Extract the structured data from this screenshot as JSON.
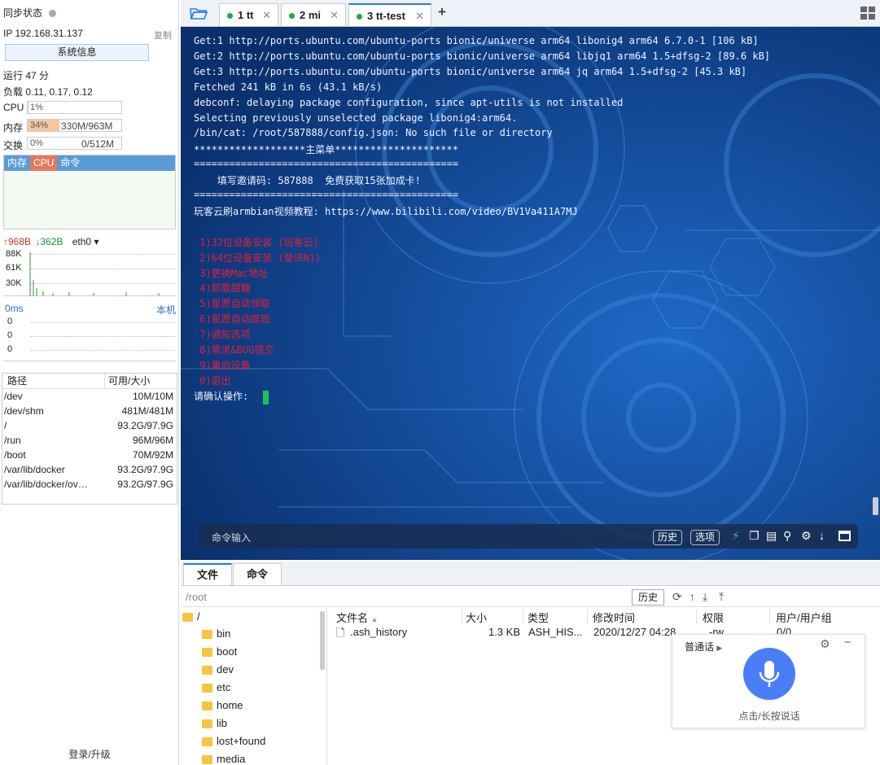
{
  "sidebar": {
    "sync_label": "同步状态",
    "ip": "IP 192.168.31.137",
    "copy": "复制",
    "sysinfo_button": "系统信息",
    "uptime": "运行 47 分",
    "load": "负载 0.11, 0.17, 0.12",
    "cpu_label": "CPU",
    "cpu_value": "1%",
    "cpu_fraction": 0.01,
    "mem_label": "内存",
    "mem_value": "34%",
    "mem_fraction": 0.34,
    "mem_detail": "330M/963M",
    "swap_label": "交换",
    "swap_value": "0%",
    "swap_fraction": 0,
    "swap_detail": "0/512M",
    "proc_tabs": [
      "内存",
      "CPU",
      "命令"
    ],
    "net_up": "↑968B",
    "net_down": "↓362B",
    "net_iface": "eth0",
    "net_yticks": [
      "88K",
      "61K",
      "30K"
    ],
    "ping_label": "0ms",
    "ping_target": "本机",
    "ping_values": [
      "0",
      "0",
      "0"
    ],
    "disk_headers": [
      "路径",
      "可用/大小"
    ],
    "disks": [
      {
        "path": "/dev",
        "size": "10M/10M"
      },
      {
        "path": "/dev/shm",
        "size": "481M/481M"
      },
      {
        "path": "/",
        "size": "93.2G/97.9G"
      },
      {
        "path": "/run",
        "size": "96M/96M"
      },
      {
        "path": "/boot",
        "size": "70M/92M"
      },
      {
        "path": "/var/lib/docker",
        "size": "93.2G/97.9G"
      },
      {
        "path": "/var/lib/docker/ov…",
        "size": "93.2G/97.9G"
      }
    ],
    "login": "登录/升级"
  },
  "tabs": [
    {
      "label": "1 tt"
    },
    {
      "label": "2 mi"
    },
    {
      "label": "3 tt-test"
    }
  ],
  "add_tab": "+",
  "terminal": {
    "lines": [
      "Get:1 http://ports.ubuntu.com/ubuntu-ports bionic/universe arm64 libonig4 arm64 6.7.0-1 [106 kB]",
      "Get:2 http://ports.ubuntu.com/ubuntu-ports bionic/universe arm64 libjq1 arm64 1.5+dfsg-2 [89.6 kB]",
      "Get:3 http://ports.ubuntu.com/ubuntu-ports bionic/universe arm64 jq arm64 1.5+dfsg-2 [45.3 kB]",
      "Fetched 241 kB in 6s (43.1 kB/s)",
      "debconf: delaying package configuration, since apt-utils is not installed",
      "Selecting previously unselected package libonig4:arm64.",
      "/bin/cat: /root/587888/config.json: No such file or directory",
      "*******************主菜单*********************",
      "=============================================",
      "    填写邀请码: 587888  免费获取15张加成卡!",
      "=============================================",
      "玩客云刷armbian视频教程: https://www.bilibili.com/video/BV1Va411A7MJ"
    ],
    "menu": [
      " 1)32位设备安装 (玩客云)",
      " 2)64位设备安装 (斐讯N1)",
      " 3)更换Mac地址",
      " 4)卸载甜糖",
      " 5)星愿自动领取",
      " 6)星愿自动提现",
      " 7)通知选项",
      " 8)需求&BUG提交",
      " 9)重启设备",
      " 0)退出"
    ],
    "prompt": "请确认操作: ",
    "cmd_placeholder": "命令输入",
    "history_btn": "历史",
    "options_btn": "选项"
  },
  "bottom_tabs": [
    "文件",
    "命令"
  ],
  "filebrowser": {
    "path": "/root",
    "history_btn": "历史",
    "tree": [
      "/",
      "bin",
      "boot",
      "dev",
      "etc",
      "home",
      "lib",
      "lost+found",
      "media"
    ],
    "headers": [
      "文件名",
      "大小",
      "类型",
      "修改时间",
      "权限",
      "用户/用户组"
    ],
    "files": [
      {
        "name": ".ash_history",
        "size": "1.3 KB",
        "type": "ASH_HIS...",
        "mtime": "2020/12/27 04:28",
        "perm": "-rw",
        "owner": "0/0"
      }
    ]
  },
  "voice": {
    "mode": "普通话",
    "hint": "点击/长按说话"
  }
}
